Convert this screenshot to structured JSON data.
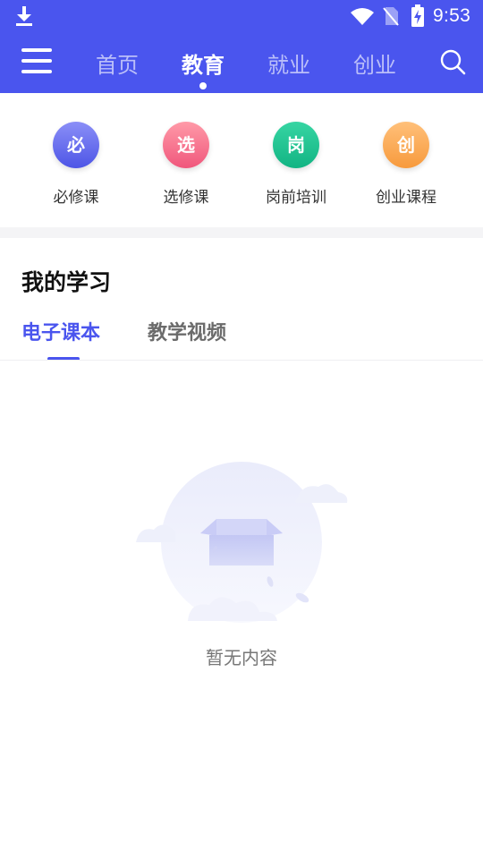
{
  "status_bar": {
    "time": "9:53",
    "icons": [
      "download-icon",
      "wifi-icon",
      "no-sim-icon",
      "battery-charging-icon"
    ]
  },
  "nav": {
    "menu_icon": "menu-icon",
    "search_icon": "search-icon",
    "tabs": [
      {
        "label": "首页"
      },
      {
        "label": "教育"
      },
      {
        "label": "就业"
      },
      {
        "label": "创业"
      }
    ],
    "active_tab": "教育"
  },
  "categories": [
    {
      "label": "必修课",
      "icon_char": "必",
      "color_top": "#8b8ff7",
      "color_bottom": "#4d55e6"
    },
    {
      "label": "选修课",
      "icon_char": "选",
      "color_top": "#ff9aa8",
      "color_bottom": "#f0577c"
    },
    {
      "label": "岗前培训",
      "icon_char": "岗",
      "color_top": "#37d5a3",
      "color_bottom": "#12b483"
    },
    {
      "label": "创业课程",
      "icon_char": "创",
      "color_top": "#ffc07a",
      "color_bottom": "#f79a3c"
    }
  ],
  "my_study": {
    "title": "我的学习",
    "tabs": [
      {
        "label": "电子课本"
      },
      {
        "label": "教学视频"
      }
    ],
    "active_tab": "电子课本",
    "empty_text": "暂无内容"
  },
  "colors": {
    "accent": "#4a55ee",
    "page_background": "#ffffff",
    "band": "#f4f4f6"
  }
}
